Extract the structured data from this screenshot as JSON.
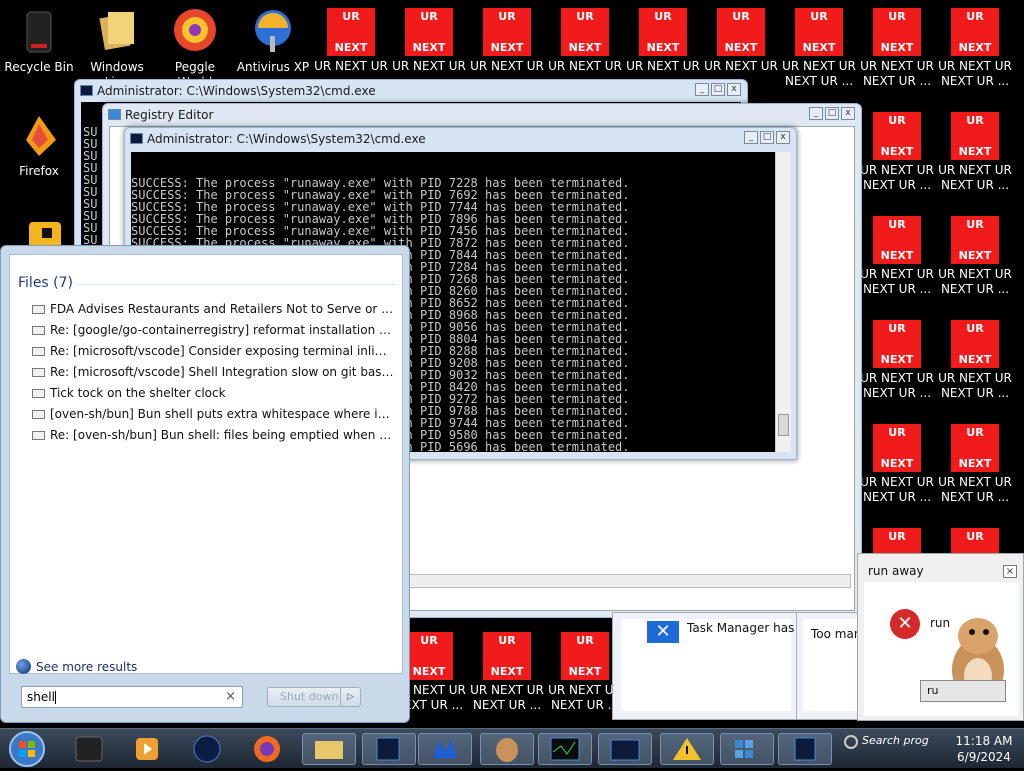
{
  "desktop": {
    "icons": [
      {
        "label": "Recycle Bin"
      },
      {
        "label": "Windows Live"
      },
      {
        "label": "Peggle World"
      },
      {
        "label": "Antivirus XP"
      },
      {
        "label": "Firefox"
      }
    ],
    "ur_icon": {
      "top": "UR",
      "bottom": "NEXT",
      "label1": "UR NEXT UR",
      "label2": "NEXT UR ..."
    }
  },
  "cmd_back": {
    "title": "Administrator: C:\\Windows\\System32\\cmd.exe",
    "prefix": "SU"
  },
  "regedit": {
    "title": "Registry Editor"
  },
  "cmd_front": {
    "title": "Administrator: C:\\Windows\\System32\\cmd.exe",
    "lines": [
      "SUCCESS: The process \"runaway.exe\" with PID 7228 has been terminated.",
      "SUCCESS: The process \"runaway.exe\" with PID 7692 has been terminated.",
      "SUCCESS: The process \"runaway.exe\" with PID 7744 has been terminated.",
      "SUCCESS: The process \"runaway.exe\" with PID 7896 has been terminated.",
      "SUCCESS: The process \"runaway.exe\" with PID 7456 has been terminated.",
      "SUCCESS: The process \"runaway.exe\" with PID 7872 has been terminated.",
      "SUCCESS: The process \"runaway.exe\" with PID 7844 has been terminated.",
      "SUCCESS: The process \"runaway.exe\" with PID 7284 has been terminated.",
      "SUCCESS: The process \"runaway.exe\" with PID 7268 has been terminated.",
      "SUCCESS: The process \"runaway.exe\" with PID 8260 has been terminated.",
      "SUCCESS: The process \"runaway.exe\" with PID 8652 has been terminated.",
      "SUCCESS: The process \"runaway.exe\" with PID 8968 has been terminated.",
      "SUCCESS: The process \"runaway.exe\" with PID 9056 has been terminated.",
      "SUCCESS: The process \"runaway.exe\" with PID 8804 has been terminated.",
      "SUCCESS: The process \"runaway.exe\" with PID 8288 has been terminated.",
      "SUCCESS: The process \"runaway.exe\" with PID 9208 has been terminated.",
      "SUCCESS: The process \"runaway.exe\" with PID 9032 has been terminated.",
      "SUCCESS: The process \"runaway.exe\" with PID 8420 has been terminated.",
      "SUCCESS: The process \"runaway.exe\" with PID 9272 has been terminated.",
      "SUCCESS: The process \"runaway.exe\" with PID 9788 has been terminated.",
      "SUCCESS: The process \"runaway.exe\" with PID 9744 has been terminated.",
      "SUCCESS: The process \"runaway.exe\" with PID 9580 has been terminated.",
      "SUCCESS: The process \"runaway.exe\" with PID 5696 has been terminated."
    ]
  },
  "start_menu": {
    "files_header": "Files (7)",
    "results": [
      "FDA Advises Restaurants and Retailers Not to Serve or Sell and ...",
      "Re: [google/go-containerregistry] reformat installation shell sni...",
      "Re: [microsoft/vscode] Consider exposing terminal inline chat i...",
      "Re: [microsoft/vscode] Shell Integration slow on git bash (Issue ...",
      "Tick tock on the shelter clock",
      "[oven-sh/bun] Bun shell puts extra whitespace where it is not n...",
      "Re: [oven-sh/bun] Bun shell: files being emptied when used wit..."
    ],
    "see_more": "See more results",
    "search_value": "shell",
    "clear_glyph": "×",
    "shutdown_label": "Shut down",
    "shutdown_arrow": "▷"
  },
  "background_windows": {
    "task_manager_text": "Task Manager has b",
    "too_many_text": "Too man"
  },
  "dialog": {
    "title": "run away",
    "close": "×",
    "partial_text": "run",
    "button_text": "ru"
  },
  "taskbar": {
    "search_text": "Search prog",
    "time": "11:18 AM",
    "date": "6/9/2024"
  }
}
